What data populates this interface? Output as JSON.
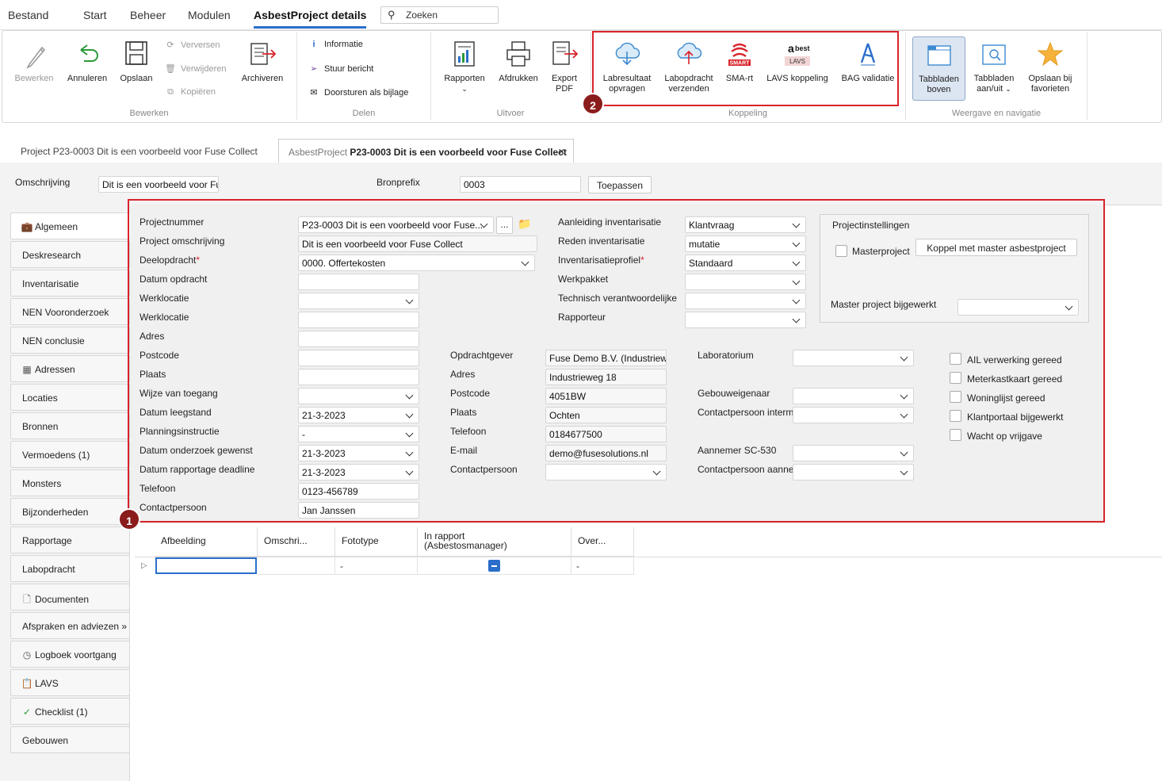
{
  "menu": {
    "file": "Bestand",
    "start": "Start",
    "beheer": "Beheer",
    "modulen": "Modulen",
    "active": "AsbestProject details",
    "search_placeholder": "Zoeken"
  },
  "ribbon": {
    "bewerken": {
      "label": "Bewerken",
      "edit": "Bewerken",
      "cancel": "Annuleren",
      "save": "Opslaan",
      "refresh": "Verversen",
      "delete": "Verwijderen",
      "copy": "Kopiëren",
      "archive": "Archiveren"
    },
    "delen": {
      "label": "Delen",
      "info": "Informatie",
      "send": "Stuur bericht",
      "forward": "Doorsturen als bijlage"
    },
    "uitvoer": {
      "label": "Uitvoer",
      "reports": "Rapporten",
      "print": "Afdrukken",
      "export_1": "Export",
      "export_2": "PDF"
    },
    "koppeling": {
      "label": "Koppeling",
      "lab_result_1": "Labresultaat",
      "lab_result_2": "opvragen",
      "lab_order_1": "Labopdracht",
      "lab_order_2": "verzenden",
      "sma": "SMA-rt",
      "lavs": "LAVS koppeling",
      "bag": "BAG validatie",
      "smart_logo": "SMART",
      "abest_logo": "best",
      "lavs_logo": "LAVS"
    },
    "weergave": {
      "label": "Weergave en navigatie",
      "tabs_top_1": "Tabbladen",
      "tabs_top_2": "boven",
      "tabs_toggle_1": "Tabbladen",
      "tabs_toggle_2": "aan/uit",
      "fav_1": "Opslaan bij",
      "fav_2": "favorieten"
    }
  },
  "badges": {
    "one": "1",
    "two": "2"
  },
  "tabs": {
    "tab1_prefix": "Project",
    "tab1_title": "P23-0003 Dit is een voorbeeld voor Fuse Collect",
    "tab2_prefix": "AsbestProject",
    "tab2_title": "P23-0003 Dit is een voorbeeld voor Fuse Collect",
    "close": "✕"
  },
  "header": {
    "omschrijving_label": "Omschrijving",
    "omschrijving_value": "Dit is een voorbeeld voor Fu",
    "bronprefix_label": "Bronprefix",
    "bronprefix_value": "0003",
    "apply": "Toepassen"
  },
  "sidenav": [
    {
      "label": "Algemeen",
      "icon": "briefcase-icon",
      "glyph": "💼"
    },
    {
      "label": "Deskresearch",
      "icon": "",
      "glyph": ""
    },
    {
      "label": "Inventarisatie",
      "icon": "",
      "glyph": ""
    },
    {
      "label": "NEN Vooronderzoek",
      "icon": "",
      "glyph": ""
    },
    {
      "label": "NEN conclusie",
      "icon": "",
      "glyph": ""
    },
    {
      "label": "Adressen",
      "icon": "building-icon",
      "glyph": "▦"
    },
    {
      "label": "Locaties",
      "icon": "",
      "glyph": ""
    },
    {
      "label": "Bronnen",
      "icon": "",
      "glyph": ""
    },
    {
      "label": "Vermoedens (1)",
      "icon": "",
      "glyph": ""
    },
    {
      "label": "Monsters",
      "icon": "",
      "glyph": ""
    },
    {
      "label": "Bijzonderheden",
      "icon": "",
      "glyph": ""
    },
    {
      "label": "Rapportage",
      "icon": "",
      "glyph": ""
    },
    {
      "label": "Labopdracht",
      "icon": "",
      "glyph": ""
    },
    {
      "label": "Documenten",
      "icon": "document-icon",
      "glyph": "🗋"
    },
    {
      "label": "Afspraken en adviezen »",
      "icon": "",
      "glyph": ""
    },
    {
      "label": "Logboek voortgang",
      "icon": "clock-icon",
      "glyph": "◷"
    },
    {
      "label": "LAVS",
      "icon": "clipboard-icon",
      "glyph": "📋"
    },
    {
      "label": "Checklist (1)",
      "icon": "check-icon",
      "glyph": "✓"
    },
    {
      "label": "Gebouwen",
      "icon": "",
      "glyph": ""
    }
  ],
  "form": {
    "col1": {
      "projectnummer": {
        "label": "Projectnummer",
        "value": "P23-0003 Dit is een voorbeeld voor Fuse..."
      },
      "project_omschrijving": {
        "label": "Project omschrijving",
        "value": "Dit is een voorbeeld voor Fuse Collect"
      },
      "deelopdracht": {
        "label": "Deelopdracht",
        "value": "0000. Offertekosten"
      },
      "datum_opdracht": {
        "label": "Datum opdracht",
        "value": ""
      },
      "werklocatie1": {
        "label": "Werklocatie",
        "value": ""
      },
      "werklocatie2": {
        "label": "Werklocatie",
        "value": ""
      },
      "adres": {
        "label": "Adres",
        "value": ""
      },
      "postcode": {
        "label": "Postcode",
        "value": ""
      },
      "plaats": {
        "label": "Plaats",
        "value": ""
      },
      "wijze_toegang": {
        "label": "Wijze van toegang",
        "value": ""
      },
      "datum_leegstand": {
        "label": "Datum leegstand",
        "value": "21-3-2023"
      },
      "planningsinstructie": {
        "label": "Planningsinstructie",
        "value": "-"
      },
      "datum_onderzoek": {
        "label": "Datum onderzoek gewenst",
        "value": "21-3-2023"
      },
      "datum_deadline": {
        "label": "Datum rapportage deadline",
        "value": "21-3-2023"
      },
      "telefoon": {
        "label": "Telefoon",
        "value": "0123-456789"
      },
      "contactpersoon": {
        "label": "Contactpersoon",
        "value": "Jan Janssen"
      },
      "ellipsis": "..."
    },
    "col2": {
      "aanleiding": {
        "label": "Aanleiding inventarisatie",
        "value": "Klantvraag"
      },
      "reden": {
        "label": "Reden inventarisatie",
        "value": "mutatie"
      },
      "profiel": {
        "label": "Inventarisatieprofiel",
        "value": "Standaard"
      },
      "werkpakket": {
        "label": "Werkpakket",
        "value": ""
      },
      "technisch": {
        "label": "Technisch verantwoordelijke",
        "value": ""
      },
      "rapporteur": {
        "label": "Rapporteur",
        "value": ""
      }
    },
    "col3": {
      "opdrachtgever": {
        "label": "Opdrachtgever",
        "value": "Fuse Demo B.V. (Industriewe"
      },
      "adres": {
        "label": "Adres",
        "value": "Industrieweg 18"
      },
      "postcode": {
        "label": "Postcode",
        "value": "4051BW"
      },
      "plaats": {
        "label": "Plaats",
        "value": "Ochten"
      },
      "telefoon": {
        "label": "Telefoon",
        "value": "0184677500"
      },
      "email": {
        "label": "E-mail",
        "value": "demo@fusesolutions.nl"
      },
      "contactpersoon": {
        "label": "Contactpersoon",
        "value": ""
      }
    },
    "col4": {
      "laboratorium": {
        "label": "Laboratorium",
        "value": ""
      },
      "gebouweigenaar": {
        "label": "Gebouweigenaar",
        "value": ""
      },
      "contact_interm": {
        "label": "Contactpersoon interm",
        "value": ""
      },
      "aannemer": {
        "label": "Aannemer SC-530",
        "value": ""
      },
      "contact_aannemer": {
        "label": "Contactpersoon aanne",
        "value": ""
      }
    },
    "projectinstellingen": {
      "title": "Projectinstellingen",
      "masterproject": "Masterproject",
      "koppel": "Koppel met master asbestproject",
      "master_bijgewerkt": "Master project bijgewerkt",
      "master_value": ""
    },
    "checks": [
      "AIL verwerking gereed",
      "Meterkastkaart gereed",
      "Woninglijst gereed",
      "Klantportaal bijgewerkt",
      "Wacht op vrijgave"
    ]
  },
  "grid": {
    "headers": [
      "Afbeelding",
      "Omschri...",
      "Fototype",
      "In rapport",
      "(Asbestosmanager)",
      "Over..."
    ],
    "row": {
      "fototype": "-",
      "over": "-"
    }
  },
  "colors": {
    "accent": "#2b6ecb",
    "highlight": "#d8232a",
    "badge": "#8b1c1c"
  }
}
